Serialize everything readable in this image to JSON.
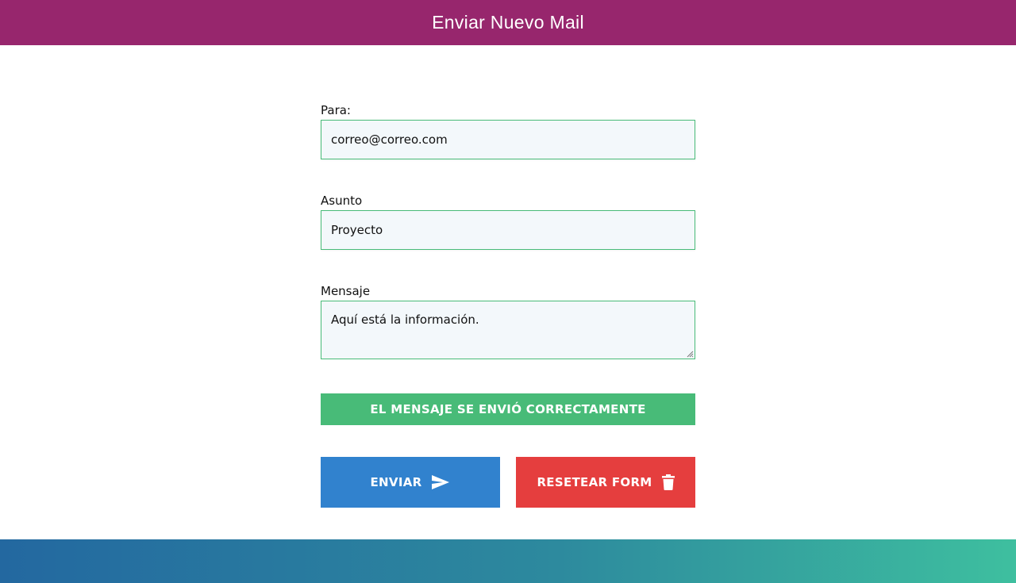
{
  "header": {
    "title": "Enviar Nuevo Mail",
    "color": "#97266d"
  },
  "form": {
    "to": {
      "label": "Para:",
      "value": "correo@correo.com"
    },
    "subject": {
      "label": "Asunto",
      "value": "Proyecto"
    },
    "message": {
      "label": "Mensaje",
      "value": "Aquí está la información."
    },
    "field_border_color": "#48bb78"
  },
  "alert": {
    "text": "EL MENSAJE SE ENVIÓ CORRECTAMENTE",
    "color": "#48bb78"
  },
  "buttons": {
    "send": {
      "label": "ENVIAR",
      "icon": "send-icon",
      "color": "#3182ce"
    },
    "reset": {
      "label": "RESETEAR FORM",
      "icon": "trash-icon",
      "color": "#e53e3e"
    }
  },
  "footer": {
    "gradient": [
      "#2368a0",
      "#3ebf9f"
    ]
  }
}
